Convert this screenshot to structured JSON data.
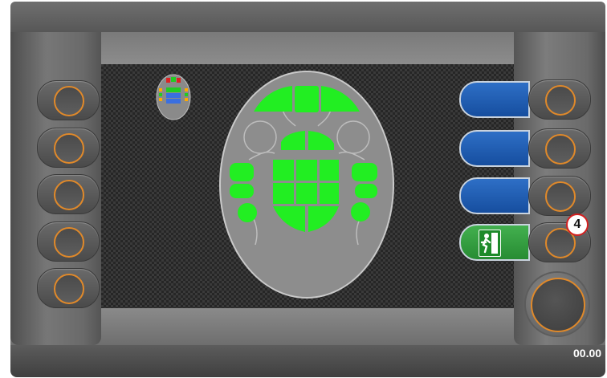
{
  "status": {
    "timer": "00.00"
  },
  "badge": {
    "label": "4"
  },
  "colors": {
    "zone_active": "#22ee22",
    "accent_ring": "#e0892a",
    "blue_key": "#1e5fb4",
    "exit_key": "#34a042"
  },
  "icons": {
    "thumbnail": "mini-bug-diagram-icon",
    "exit": "emergency-exit-icon",
    "bug": "bug-outline-icon"
  }
}
